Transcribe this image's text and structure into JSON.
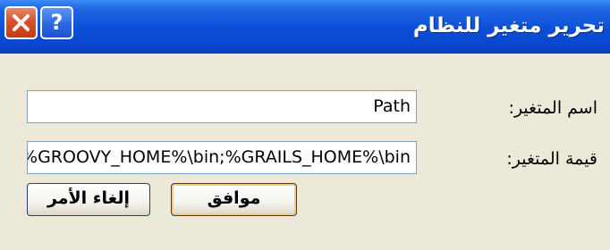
{
  "window": {
    "title": "تحرير متغير للنظام",
    "close_icon": "close-icon",
    "help_label": "?"
  },
  "form": {
    "name_label": "اسم المتغير:",
    "name_value": "Path",
    "value_label": "قيمة المتغير:",
    "value_value": "%GROOVY_HOME%\\bin;%GRAILS_HOME%\\bin"
  },
  "buttons": {
    "ok_label": "موافق",
    "cancel_label": "إلغاء الأمر"
  }
}
